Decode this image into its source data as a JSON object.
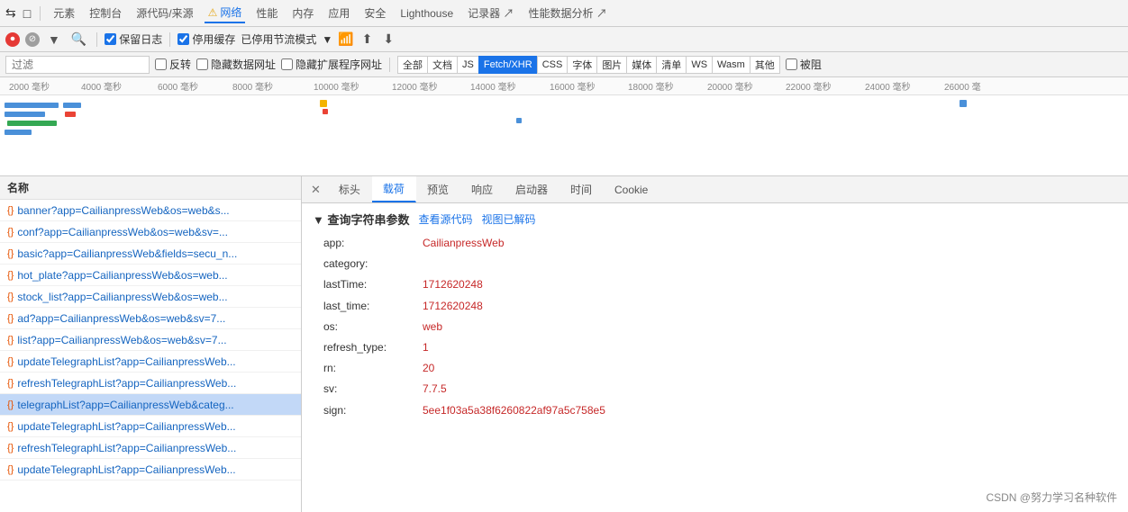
{
  "toolbar": {
    "icons": [
      "⇆",
      "□"
    ],
    "nav_items": [
      "元素",
      "控制台",
      "源代码/来源",
      "网络",
      "性能",
      "内存",
      "应用",
      "安全",
      "Lighthouse",
      "记录器 ↗",
      "性能数据分析 ↗"
    ],
    "active_nav": "网络",
    "warning_nav": "网络",
    "buttons": {
      "record": "⏺",
      "clear": "⊘",
      "filter": "▼",
      "search": "🔍",
      "preserve_log": "保留日志",
      "disable_cache": "停用缓存",
      "no_throttle": "已停用节流模式",
      "offline_icon": "📶",
      "upload_icon": "⬆",
      "download_icon": "⬇"
    }
  },
  "filter": {
    "placeholder": "过滤",
    "reverse_label": "反转",
    "hide_data_urls_label": "隐藏数据网址",
    "hide_extension_urls_label": "隐藏扩展程序网址",
    "type_buttons": [
      "全部",
      "文档",
      "JS",
      "Fetch/XHR",
      "CSS",
      "字体",
      "图片",
      "媒体",
      "清单",
      "WS",
      "Wasm",
      "其他"
    ],
    "active_type": "Fetch/XHR",
    "blocked_label": "被阻"
  },
  "timeline": {
    "ticks": [
      "2000 毫秒",
      "4000 毫秒",
      "6000 毫秒",
      "8000 毫秒",
      "10000 毫秒",
      "12000 毫秒",
      "14000 毫秒",
      "16000 毫秒",
      "18000 毫秒",
      "20000 毫秒",
      "22000 毫秒",
      "24000 毫秒",
      "26000 毫"
    ]
  },
  "network_list": {
    "header": "名称",
    "items": [
      {
        "id": 1,
        "name": "banner?app=CailianpressWeb&os=web&s...",
        "selected": false
      },
      {
        "id": 2,
        "name": "conf?app=CailianpressWeb&os=web&sv=...",
        "selected": false
      },
      {
        "id": 3,
        "name": "basic?app=CailianpressWeb&fields=secu_n...",
        "selected": false
      },
      {
        "id": 4,
        "name": "hot_plate?app=CailianpressWeb&os=web...",
        "selected": false
      },
      {
        "id": 5,
        "name": "stock_list?app=CailianpressWeb&os=web...",
        "selected": false
      },
      {
        "id": 6,
        "name": "ad?app=CailianpressWeb&os=web&sv=7...",
        "selected": false
      },
      {
        "id": 7,
        "name": "list?app=CailianpressWeb&os=web&sv=7...",
        "selected": false
      },
      {
        "id": 8,
        "name": "updateTelegraphList?app=CailianpressWeb...",
        "selected": false
      },
      {
        "id": 9,
        "name": "refreshTelegraphList?app=CailianpressWeb...",
        "selected": false
      },
      {
        "id": 10,
        "name": "telegraphList?app=CailianpressWeb&categ...",
        "selected": true
      },
      {
        "id": 11,
        "name": "updateTelegraphList?app=CailianpressWeb...",
        "selected": false
      },
      {
        "id": 12,
        "name": "refreshTelegraphList?app=CailianpressWeb...",
        "selected": false
      },
      {
        "id": 13,
        "name": "updateTelegraphList?app=CailianpressWeb...",
        "selected": false
      }
    ]
  },
  "detail_panel": {
    "tabs": [
      "标头",
      "载荷",
      "预览",
      "响应",
      "启动器",
      "时间",
      "Cookie"
    ],
    "active_tab": "载荷",
    "close_btn": "✕",
    "payload": {
      "section_title": "▼ 查询字符串参数",
      "action1": "查看源代码",
      "action2": "视图已解码",
      "params": [
        {
          "key": "app:",
          "value": "CailianpressWeb",
          "empty": false
        },
        {
          "key": "category:",
          "value": "",
          "empty": true
        },
        {
          "key": "lastTime:",
          "value": "1712620248",
          "empty": false
        },
        {
          "key": "last_time:",
          "value": "1712620248",
          "empty": false
        },
        {
          "key": "os:",
          "value": "web",
          "empty": false
        },
        {
          "key": "refresh_type:",
          "value": "1",
          "empty": false
        },
        {
          "key": "rn:",
          "value": "20",
          "empty": false
        },
        {
          "key": "sv:",
          "value": "7.7.5",
          "empty": false
        },
        {
          "key": "sign:",
          "value": "5ee1f03a5a38f6260822af97a5c758e5",
          "empty": false
        }
      ]
    }
  },
  "watermark": "CSDN @努力学习名种软件"
}
